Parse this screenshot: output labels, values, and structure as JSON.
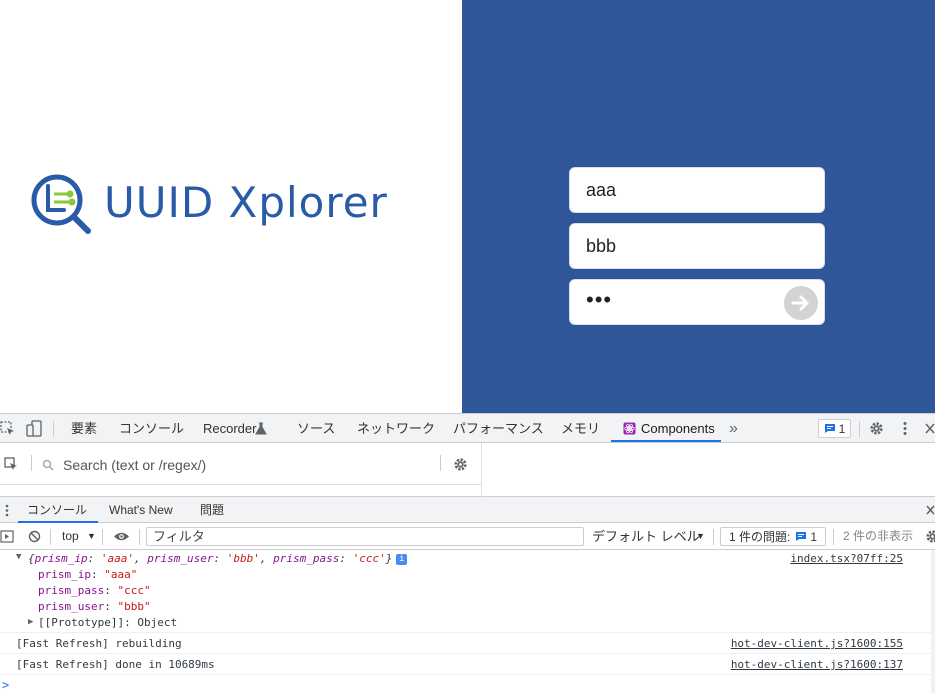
{
  "app": {
    "logo_text": "UUID Xplorer",
    "brand_color": "#2a5ba8",
    "panel_color": "#2f5699",
    "login": {
      "ip_value": "aaa",
      "user_value": "bbb",
      "pass_mask": "•••"
    }
  },
  "devtools": {
    "tabs": [
      "要素",
      "コンソール",
      "Recorder",
      "ソース",
      "ネットワーク",
      "パフォーマンス",
      "メモリ",
      "Components"
    ],
    "recorder_icon": "flask-icon",
    "more_tabs": "»",
    "issue_count": "1",
    "components_search_placeholder": "Search (text or /regex/)",
    "drawer_tabs": [
      "コンソール",
      "What's New",
      "問題"
    ],
    "console_toolbar": {
      "context": "top",
      "filter_placeholder": "フィルタ",
      "level": "デフォルト レベル",
      "issues_label": "1 件の問題:",
      "issues_count": "1",
      "hidden": "2 件の非表示"
    },
    "logs": [
      {
        "preview_open": "{",
        "preview_items": [
          {
            "key": "prism_ip",
            "value": "'aaa'"
          },
          {
            "key": "prism_user",
            "value": "'bbb'"
          },
          {
            "key": "prism_pass",
            "value": "'ccc'"
          }
        ],
        "preview_close": "}",
        "info": "i",
        "source": "index.tsx?07ff:25",
        "props": [
          {
            "key": "prism_ip",
            "value": "\"aaa\""
          },
          {
            "key": "prism_pass",
            "value": "\"ccc\""
          },
          {
            "key": "prism_user",
            "value": "\"bbb\""
          }
        ],
        "prototype": "[[Prototype]]: Object"
      },
      {
        "text": "[Fast Refresh] rebuilding",
        "source": "hot-dev-client.js?1600:155"
      },
      {
        "text": "[Fast Refresh] done in 10689ms",
        "source": "hot-dev-client.js?1600:137"
      }
    ],
    "prompt": ">"
  }
}
